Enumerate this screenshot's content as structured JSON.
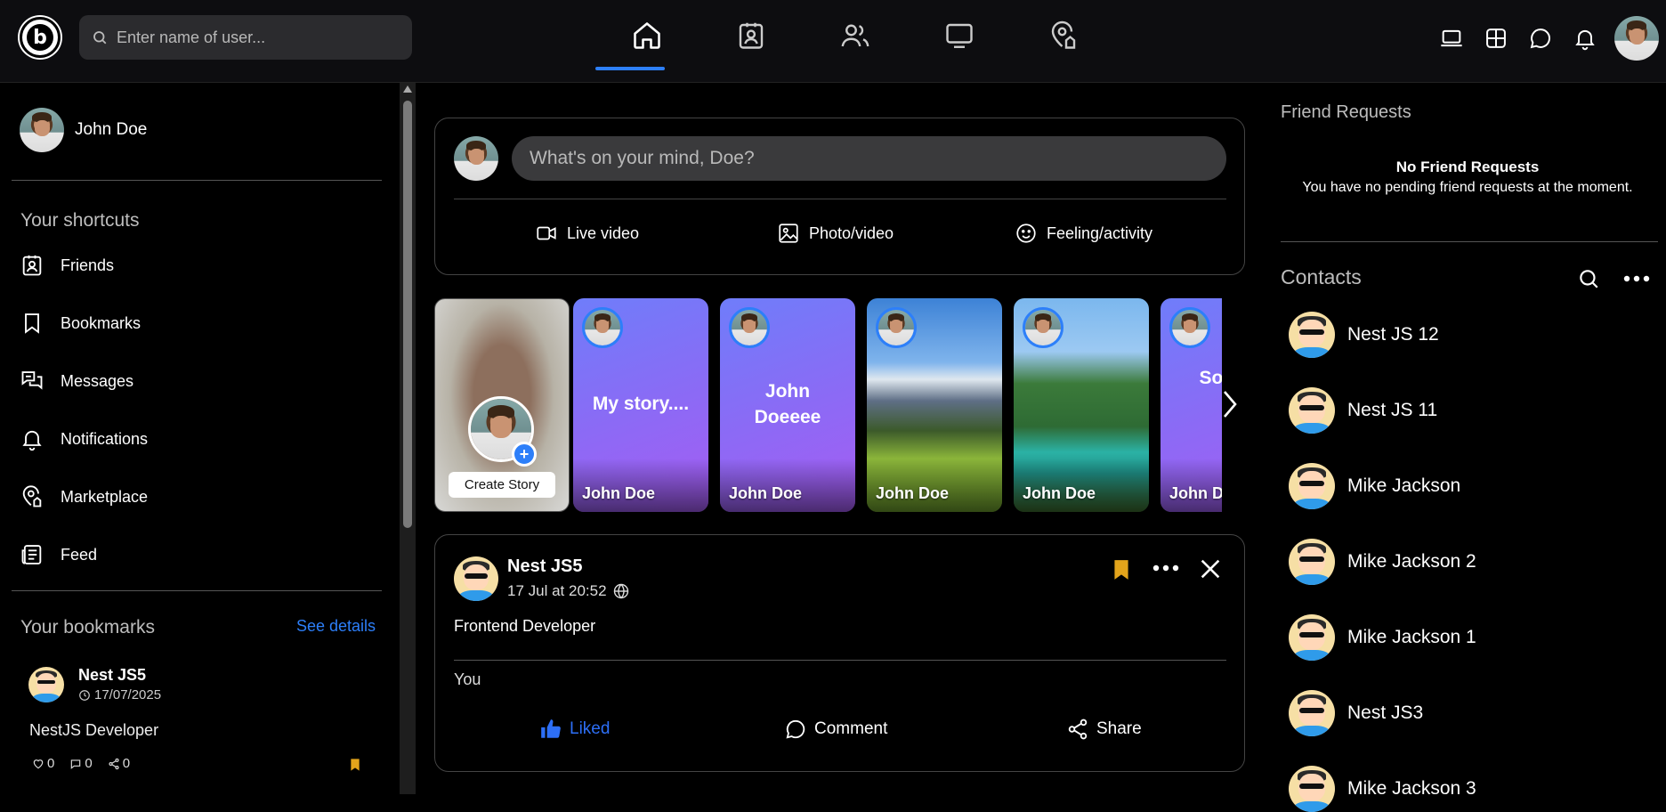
{
  "header": {
    "logo_letter": "b",
    "search_placeholder": "Enter name of user...",
    "nav": [
      "home-icon",
      "friends-card-icon",
      "groups-icon",
      "watch-icon",
      "marketplace-icon"
    ],
    "right_icons": [
      "laptop-icon",
      "grid-icon",
      "chat-icon",
      "bell-icon"
    ]
  },
  "sidebar": {
    "user_name": "John Doe",
    "shortcuts_title": "Your shortcuts",
    "shortcuts": [
      {
        "label": "Friends",
        "icon": "friends-icon"
      },
      {
        "label": "Bookmarks",
        "icon": "bookmark-icon"
      },
      {
        "label": "Messages",
        "icon": "messages-icon"
      },
      {
        "label": "Notifications",
        "icon": "bell-icon"
      },
      {
        "label": "Marketplace",
        "icon": "marketplace-icon"
      },
      {
        "label": "Feed",
        "icon": "feed-icon"
      }
    ],
    "bookmarks_title": "Your bookmarks",
    "see_details": "See details",
    "bookmark": {
      "name": "Nest JS5",
      "date": "17/07/2025",
      "desc": "NestJS Developer",
      "likes": "0",
      "comments": "0",
      "shares": "0"
    }
  },
  "composer": {
    "placeholder": "What's on your mind, Doe?",
    "live": "Live video",
    "photo": "Photo/video",
    "feeling": "Feeling/activity"
  },
  "stories": {
    "create_label": "Create Story",
    "plus": "+",
    "items": [
      {
        "owner": "John Doe",
        "text": "My story....",
        "bg": "gradient"
      },
      {
        "owner": "John Doe",
        "text": "John Doeeee",
        "bg": "gradient"
      },
      {
        "owner": "John Doe",
        "text": "",
        "bg": "mountain"
      },
      {
        "owner": "John Doe",
        "text": "",
        "bg": "waterfall"
      },
      {
        "owner": "John Do",
        "text": "So Net Plat",
        "bg": "gradient"
      }
    ]
  },
  "post": {
    "author": "Nest JS5",
    "date": "17 Jul at 20:52",
    "content": "Frontend Developer",
    "liked_by": "You",
    "like_label": "Liked",
    "comment_label": "Comment",
    "share_label": "Share",
    "accent": "#2d6ff7",
    "bookmark_color": "#e3a41b"
  },
  "right": {
    "friend_requests_title": "Friend Requests",
    "no_requests_title": "No Friend Requests",
    "no_requests_text": "You have no pending friend requests at the moment.",
    "contacts_title": "Contacts",
    "contacts": [
      "Nest JS 12",
      "Nest JS 11",
      "Mike Jackson",
      "Mike Jackson 2",
      "Mike Jackson 1",
      "Nest JS3",
      "Mike Jackson 3"
    ]
  }
}
